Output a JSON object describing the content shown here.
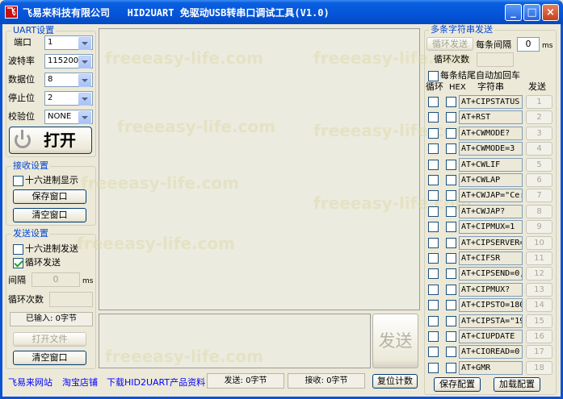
{
  "window": {
    "title": "飞易来科技有限公司   HID2UART 免驱动USB转串口调试工具(V1.0)",
    "icon_glyph": "飞",
    "minimize": "_",
    "maximize": "□",
    "close": "×"
  },
  "uart": {
    "group_label": "UART设置",
    "port_label": "端口",
    "port_value": "1",
    "baud_label": "波特率",
    "baud_value": "115200",
    "databits_label": "数据位",
    "databits_value": "8",
    "stopbits_label": "停止位",
    "stopbits_value": "2",
    "parity_label": "校验位",
    "parity_value": "NONE",
    "open_label": "打开"
  },
  "receive": {
    "group_label": "接收设置",
    "hex_label": "十六进制显示",
    "hex_checked": false,
    "save_label": "保存窗口",
    "clear_label": "清空窗口"
  },
  "sendset": {
    "group_label": "发送设置",
    "hex_label": "十六进制发送",
    "hex_checked": false,
    "loop_label": "循环发送",
    "loop_checked": true,
    "interval_label": "间隔",
    "interval_value": "0",
    "interval_unit": "ms",
    "count_label": "循环次数",
    "count_value": "",
    "input_status": "已输入: 0字节",
    "open_file_label": "打开文件",
    "clear_label": "清空窗口"
  },
  "main": {
    "send_button": "发送"
  },
  "watermarks": [
    "freeeasy-life.com",
    "freeeasy-life.com",
    "freeeasy-life.com",
    "freeeasy-life.com",
    "freeeasy-life.com",
    "freeeasy-life.com",
    "freeeasy-life.com",
    "freeeasy-life.com"
  ],
  "multi": {
    "group_label": "多条字符串发送",
    "loop_send_label": "循环发送",
    "interval_label": "每条间隔",
    "interval_value": "0",
    "interval_unit": "ms",
    "count_label": "循环次数",
    "count_value": "",
    "auto_cr_label": "每条结尾自动加回车",
    "col_loop": "循环",
    "col_hex": "HEX",
    "col_string": "字符串",
    "col_send": "发送",
    "rows": [
      {
        "cmd": "AT+CIPSTATUS",
        "n": "1"
      },
      {
        "cmd": "AT+RST",
        "n": "2"
      },
      {
        "cmd": "AT+CWMODE?",
        "n": "3"
      },
      {
        "cmd": "AT+CWMODE=3",
        "n": "4"
      },
      {
        "cmd": "AT+CWLIF",
        "n": "5"
      },
      {
        "cmd": "AT+CWLAP",
        "n": "6"
      },
      {
        "cmd": "AT+CWJAP=\"Ce:",
        "n": "7"
      },
      {
        "cmd": "AT+CWJAP?",
        "n": "8"
      },
      {
        "cmd": "AT+CIPMUX=1",
        "n": "9"
      },
      {
        "cmd": "AT+CIPSERVER=",
        "n": "10"
      },
      {
        "cmd": "AT+CIFSR",
        "n": "11"
      },
      {
        "cmd": "AT+CIPSEND=0,",
        "n": "12"
      },
      {
        "cmd": "AT+CIPMUX?",
        "n": "13"
      },
      {
        "cmd": "AT+CIPSTO=180",
        "n": "14"
      },
      {
        "cmd": "AT+CIPSTA=\"19",
        "n": "15"
      },
      {
        "cmd": "AT+CIUPDATE",
        "n": "16"
      },
      {
        "cmd": "AT+CIOREAD=0",
        "n": "17"
      },
      {
        "cmd": "AT+GMR",
        "n": "18"
      }
    ],
    "save_label": "保存配置",
    "load_label": "加载配置"
  },
  "footer": {
    "link_site": "飞易来网站",
    "link_shop": "淘宝店铺",
    "link_download": "下载HID2UART产品资料",
    "send_count": "发送: 0字节",
    "recv_count": "接收: 0字节",
    "reset_label": "复位计数"
  },
  "colors": {
    "titlebar": "#0554d8",
    "group_label": "#0046d5",
    "link": "#0000ff",
    "face": "#ece9d8"
  }
}
